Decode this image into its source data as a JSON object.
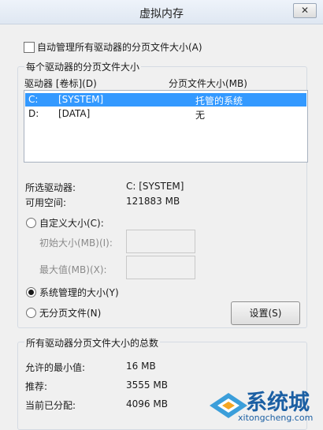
{
  "window": {
    "title": "虚拟内存",
    "close_glyph": "✕"
  },
  "auto_manage": {
    "label": "自动管理所有驱动器的分页文件大小(A)",
    "checked": false
  },
  "drive_group": {
    "label": "每个驱动器的分页文件大小",
    "col_drive": "驱动器 [卷标](D)",
    "col_size": "分页文件大小(MB)",
    "drives": [
      {
        "drive": "C:",
        "label": "[SYSTEM]",
        "size": "托管的系统",
        "selected": true
      },
      {
        "drive": "D:",
        "label": "[DATA]",
        "size": "无",
        "selected": false
      }
    ],
    "selected_drive_label": "所选驱动器:",
    "selected_drive_value": "C:  [SYSTEM]",
    "free_space_label": "可用空间:",
    "free_space_value": "121883 MB",
    "custom_size_label": "自定义大小(C):",
    "initial_size_label": "初始大小(MB)(I):",
    "max_size_label": "最大值(MB)(X):",
    "system_managed_label": "系统管理的大小(Y)",
    "no_paging_label": "无分页文件(N)",
    "selected_option": "system_managed",
    "set_button": "设置(S)"
  },
  "total_group": {
    "label": "所有驱动器分页文件大小的总数",
    "min_label": "允许的最小值:",
    "min_value": "16 MB",
    "recommended_label": "推荐:",
    "recommended_value": "3555 MB",
    "current_label": "当前已分配:",
    "current_value": "4096 MB"
  },
  "watermark": {
    "brand": "系统城",
    "url": "xitongcheng.com"
  },
  "colors": {
    "selection": "#3399ff",
    "brand": "#1b5fa3"
  }
}
